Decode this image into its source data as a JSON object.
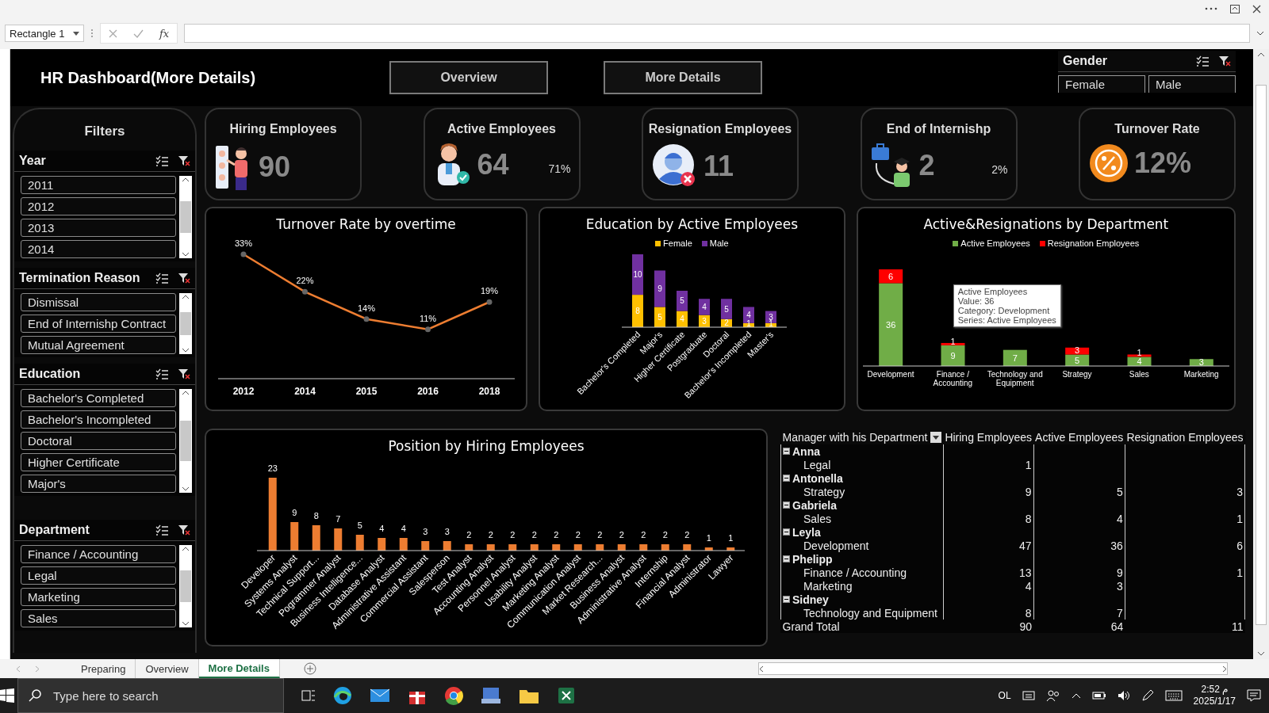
{
  "formula_bar": {
    "name_box": "Rectangle 1",
    "function_label": "fx"
  },
  "dashboard": {
    "title": "HR Dashboard(More Details)",
    "nav_buttons": [
      "Overview",
      "More Details"
    ]
  },
  "gender_slicer": {
    "title": "Gender",
    "items": [
      "Female",
      "Male"
    ]
  },
  "filters": {
    "title": "Filters",
    "slicers": [
      {
        "title": "Year",
        "items": [
          "2011",
          "2012",
          "2013",
          "2014"
        ]
      },
      {
        "title": "Termination Reason",
        "items": [
          "Dismissal",
          "End of Internishp Contract",
          "Mutual Agreement"
        ]
      },
      {
        "title": "Education",
        "items": [
          "Bachelor's Completed",
          "Bachelor's Incompleted",
          "Doctoral",
          "Higher Certificate",
          "Major's"
        ]
      },
      {
        "title": "Department",
        "items": [
          "Finance / Accounting",
          "Legal",
          "Marketing",
          "Sales"
        ]
      }
    ]
  },
  "kpis": [
    {
      "kind": "hiring",
      "title": "Hiring Employees",
      "value": "90"
    },
    {
      "kind": "active",
      "title": "Active Employees",
      "value": "64",
      "percent": "71%"
    },
    {
      "kind": "resignation",
      "title": "Resignation Employees",
      "value": "11"
    },
    {
      "kind": "internship",
      "title": "End of Internishp",
      "value": "2",
      "percent": "2%"
    },
    {
      "kind": "turnover",
      "title": "Turnover Rate",
      "value": "12%"
    }
  ],
  "turnover_chart": {
    "chart_data": {
      "type": "line",
      "title": "Turnover Rate by overtime",
      "categories": [
        "2012",
        "2014",
        "2015",
        "2016",
        "2018"
      ],
      "values": [
        33,
        22,
        14,
        11,
        19
      ],
      "marker": true,
      "value_labels": [
        "33%",
        "22%",
        "14%",
        "11%",
        "19%"
      ]
    }
  },
  "education_chart": {
    "chart_data": {
      "type": "bar",
      "title": "Education by Active Employees",
      "stacked": true,
      "legend": "top",
      "data_labels": true,
      "categories": [
        "Bachelor's Completed",
        "Major's",
        "Higher Certificate",
        "Postgraduate",
        "Doctoral",
        "Bachelor's Incompleted",
        "Master's"
      ],
      "series": [
        {
          "name": "Female",
          "color": "#ffc000",
          "values": [
            8,
            5,
            4,
            3,
            2,
            1,
            1
          ]
        },
        {
          "name": "Male",
          "color": "#7030a0",
          "values": [
            10,
            9,
            5,
            4,
            5,
            4,
            3
          ]
        }
      ]
    }
  },
  "department_chart": {
    "chart_data": {
      "type": "bar",
      "title": "Active&Resignations by Department",
      "stacked": true,
      "legend": "top",
      "data_labels": true,
      "categories": [
        "Development",
        "Finance / Accounting",
        "Technology and Equipment",
        "Strategy",
        "Sales",
        "Marketing"
      ],
      "series": [
        {
          "name": "Active Employees",
          "color": "#70ad47",
          "values": [
            36,
            9,
            7,
            5,
            4,
            3
          ]
        },
        {
          "name": "Resignation Employees",
          "color": "#ff0000",
          "values": [
            6,
            1,
            null,
            3,
            1,
            null
          ]
        }
      ]
    },
    "tooltip": [
      "Active Employees",
      "Value: 36",
      "Category: Development",
      "Series: Active Employees"
    ]
  },
  "position_chart": {
    "chart_data": {
      "type": "bar",
      "title": "Position by Hiring Employees",
      "data_labels": true,
      "categories": [
        "Developer",
        "Systems Analyst",
        "Technical Support...",
        "Pogrammer Analyst",
        "Business Intelligence...",
        "Database Analyst",
        "Administrative Assistant",
        "Commercial Assistant",
        "Salesperson",
        "Test Analyst",
        "Accounting Analyst",
        "Personnel Analyst",
        "Usability Analyst",
        "Marketing Analyst",
        "Communication Analyst",
        "Market Research...",
        "Business Analyst",
        "Administrative Analyst",
        "Internship",
        "Financial Analyst",
        "Administrator",
        "Lawyer"
      ],
      "values": [
        23,
        9,
        8,
        7,
        5,
        4,
        4,
        3,
        3,
        2,
        2,
        2,
        2,
        2,
        2,
        2,
        2,
        2,
        2,
        2,
        1,
        1
      ]
    }
  },
  "pivot": {
    "columns": [
      "Manager with his Department",
      "Hiring Employees",
      "Active Employees",
      "Resignation Employees"
    ],
    "groups": [
      {
        "name": "Anna",
        "expanded": true,
        "children": [
          {
            "name": "Legal",
            "hiring": "1"
          }
        ]
      },
      {
        "name": "Antonella",
        "expanded": true,
        "children": [
          {
            "name": "Strategy",
            "hiring": "9",
            "active": "5",
            "resignation": "3"
          }
        ]
      },
      {
        "name": "Gabriela",
        "expanded": true,
        "children": [
          {
            "name": "Sales",
            "hiring": "8",
            "active": "4",
            "resignation": "1"
          }
        ]
      },
      {
        "name": "Leyla",
        "expanded": true,
        "children": [
          {
            "name": "Development",
            "hiring": "47",
            "active": "36",
            "resignation": "6"
          }
        ]
      },
      {
        "name": "Phelipp",
        "expanded": true,
        "children": [
          {
            "name": "Finance / Accounting",
            "hiring": "13",
            "active": "9",
            "resignation": "1"
          },
          {
            "name": "Marketing",
            "hiring": "4",
            "active": "3"
          }
        ]
      },
      {
        "name": "Sidney",
        "expanded": true,
        "children": [
          {
            "name": "Technology and Equipment",
            "hiring": "8",
            "active": "7"
          }
        ]
      }
    ],
    "grand_total": {
      "label": "Grand Total",
      "hiring": "90",
      "active": "64",
      "resignation": "11"
    }
  },
  "sheet_tabs": [
    {
      "label": "Preparing",
      "selected": false
    },
    {
      "label": "Overview",
      "selected": false
    },
    {
      "label": "More Details",
      "selected": true
    }
  ],
  "taskbar": {
    "search_placeholder": "Type here to search",
    "language": "OL",
    "time": "2:52 م",
    "date": "2025/1/17"
  }
}
